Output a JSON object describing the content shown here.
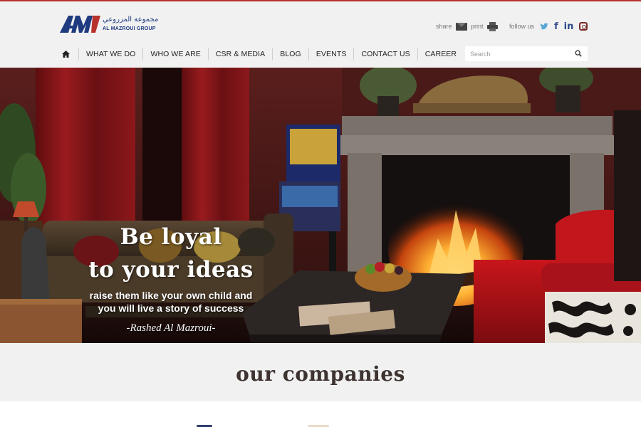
{
  "brand": {
    "logo_mark": "AM",
    "logo_arabic": "مجموعة المزروعي",
    "logo_english": "AL MAZROUI GROUP",
    "accent_color": "#b8322c",
    "brand_blue": "#1f3b80"
  },
  "utility": {
    "share_label": "share",
    "share_icon": "envelope-icon",
    "print_label": "print",
    "print_icon": "printer-icon",
    "follow_label": "follow us",
    "social_icons": [
      "twitter-icon",
      "facebook-icon",
      "linkedin-icon",
      "instagram-icon"
    ],
    "facebook_glyph": "f",
    "linkedin_glyph": "in"
  },
  "nav": {
    "home_icon": "home-icon",
    "items": [
      {
        "label": "WHAT WE DO"
      },
      {
        "label": "WHO WE ARE"
      },
      {
        "label": "CSR & MEDIA"
      },
      {
        "label": "BLOG"
      },
      {
        "label": "EVENTS"
      },
      {
        "label": "CONTACT US"
      },
      {
        "label": "CAREER"
      }
    ]
  },
  "search": {
    "placeholder": "Search",
    "icon": "search-icon"
  },
  "hero": {
    "line1": "Be loyal",
    "line2": "to your ideas",
    "line3": "raise them like your own child and",
    "line4": "you will live a story of success",
    "author": "-Rashed Al Mazroui-"
  },
  "companies": {
    "title": "our companies"
  }
}
